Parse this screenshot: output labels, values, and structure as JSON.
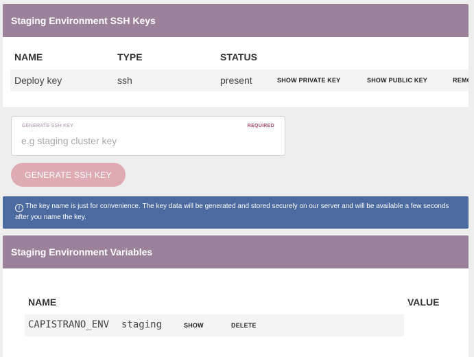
{
  "ssh_panel": {
    "title": "Staging Environment SSH Keys",
    "columns": [
      "NAME",
      "TYPE",
      "STATUS"
    ],
    "row": {
      "name": "Deploy key",
      "type": "ssh",
      "status": "present",
      "show_private": "SHOW PRIVATE KEY",
      "show_public": "SHOW PUBLIC KEY",
      "remove": "REMOVE"
    }
  },
  "generate": {
    "label": "GENERATE SSH KEY",
    "required": "REQUIRED",
    "placeholder": "e.g staging cluster key",
    "button": "GENERATE SSH KEY"
  },
  "info": {
    "icon": "info-circle-icon",
    "text": "The key name is just for convenience. The key data will be generated and stored securely on our server and will be available a few seconds after you name the key."
  },
  "vars_panel": {
    "title": "Staging Environment Variables",
    "columns": [
      "NAME",
      "VALUE"
    ],
    "row": {
      "name": "CAPISTRANO_ENV",
      "value": "staging",
      "show": "SHOW",
      "delete": "DELETE"
    }
  },
  "colors": {
    "header": "#9b8199",
    "button": "#dfabb3",
    "info": "#4a6aa0",
    "required": "#a24c6b"
  }
}
